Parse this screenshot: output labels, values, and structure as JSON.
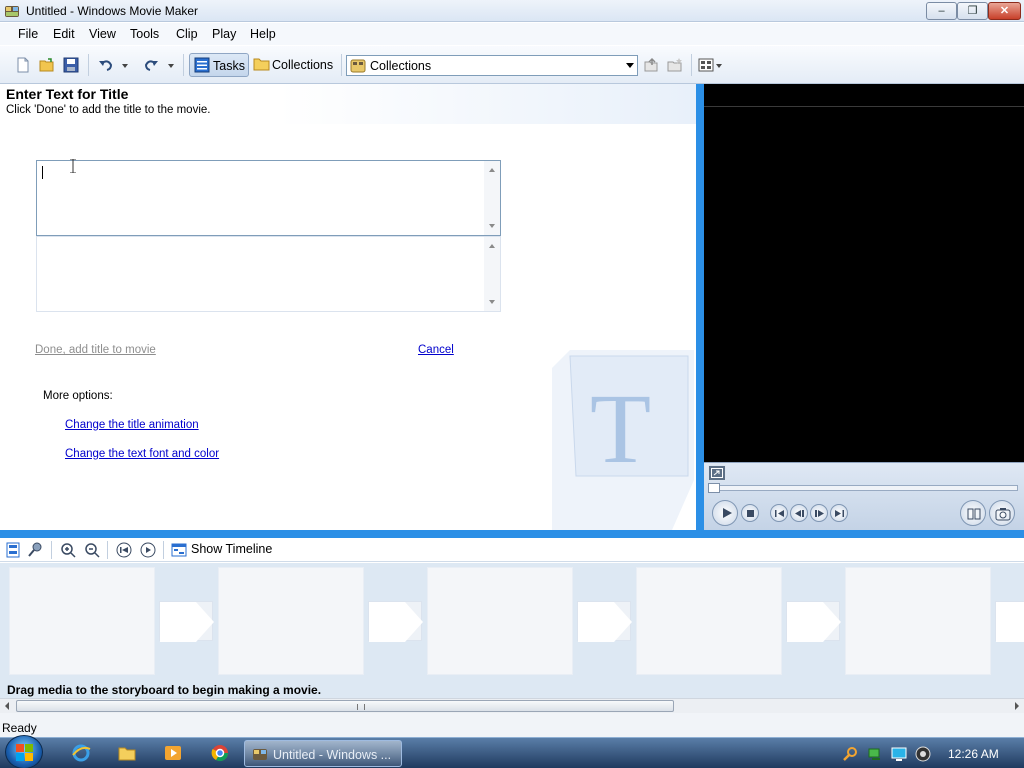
{
  "window": {
    "title": "Untitled - Windows Movie Maker"
  },
  "menu": [
    "File",
    "Edit",
    "View",
    "Tools",
    "Clip",
    "Play",
    "Help"
  ],
  "toolbar": {
    "tasks_label": "Tasks",
    "collections_label": "Collections",
    "collections_combo_value": "Collections"
  },
  "taskpane": {
    "heading": "Enter Text for Title",
    "instruction": "Click 'Done' to add the title to the movie.",
    "title_text": "",
    "subtitle_text": "",
    "done_link": "Done, add title to movie",
    "cancel_link": "Cancel",
    "more_options_label": "More options:",
    "links": [
      "Change the title animation",
      "Change the text font and color"
    ]
  },
  "storyboard": {
    "toolbar_show_timeline": "Show Timeline",
    "hint": "Drag media to the storyboard to begin making a movie."
  },
  "status": {
    "text": "Ready"
  },
  "taskbar": {
    "active_task": "Untitled - Windows ...",
    "clock": "12:26 AM"
  },
  "colors": {
    "accent_blue": "#2b8fe6",
    "link": "#0000cc",
    "disabled_link": "#8e8e8e"
  },
  "icons": [
    "app-icon",
    "new-project-icon",
    "open-project-icon",
    "save-icon",
    "undo-icon",
    "redo-icon",
    "tasks-icon",
    "folder-icon",
    "collections-icon",
    "up-folder-icon",
    "new-folder-icon",
    "views-icon",
    "title-T-watermark",
    "play-icon",
    "stop-icon",
    "rewind-icon",
    "previous-frame-icon",
    "next-frame-icon",
    "forward-icon",
    "split-icon",
    "snapshot-icon",
    "storyboard-icon",
    "narrate-icon",
    "zoom-in-icon",
    "zoom-out-icon",
    "rewind-storyboard-icon",
    "play-storyboard-icon",
    "timeline-icon"
  ]
}
